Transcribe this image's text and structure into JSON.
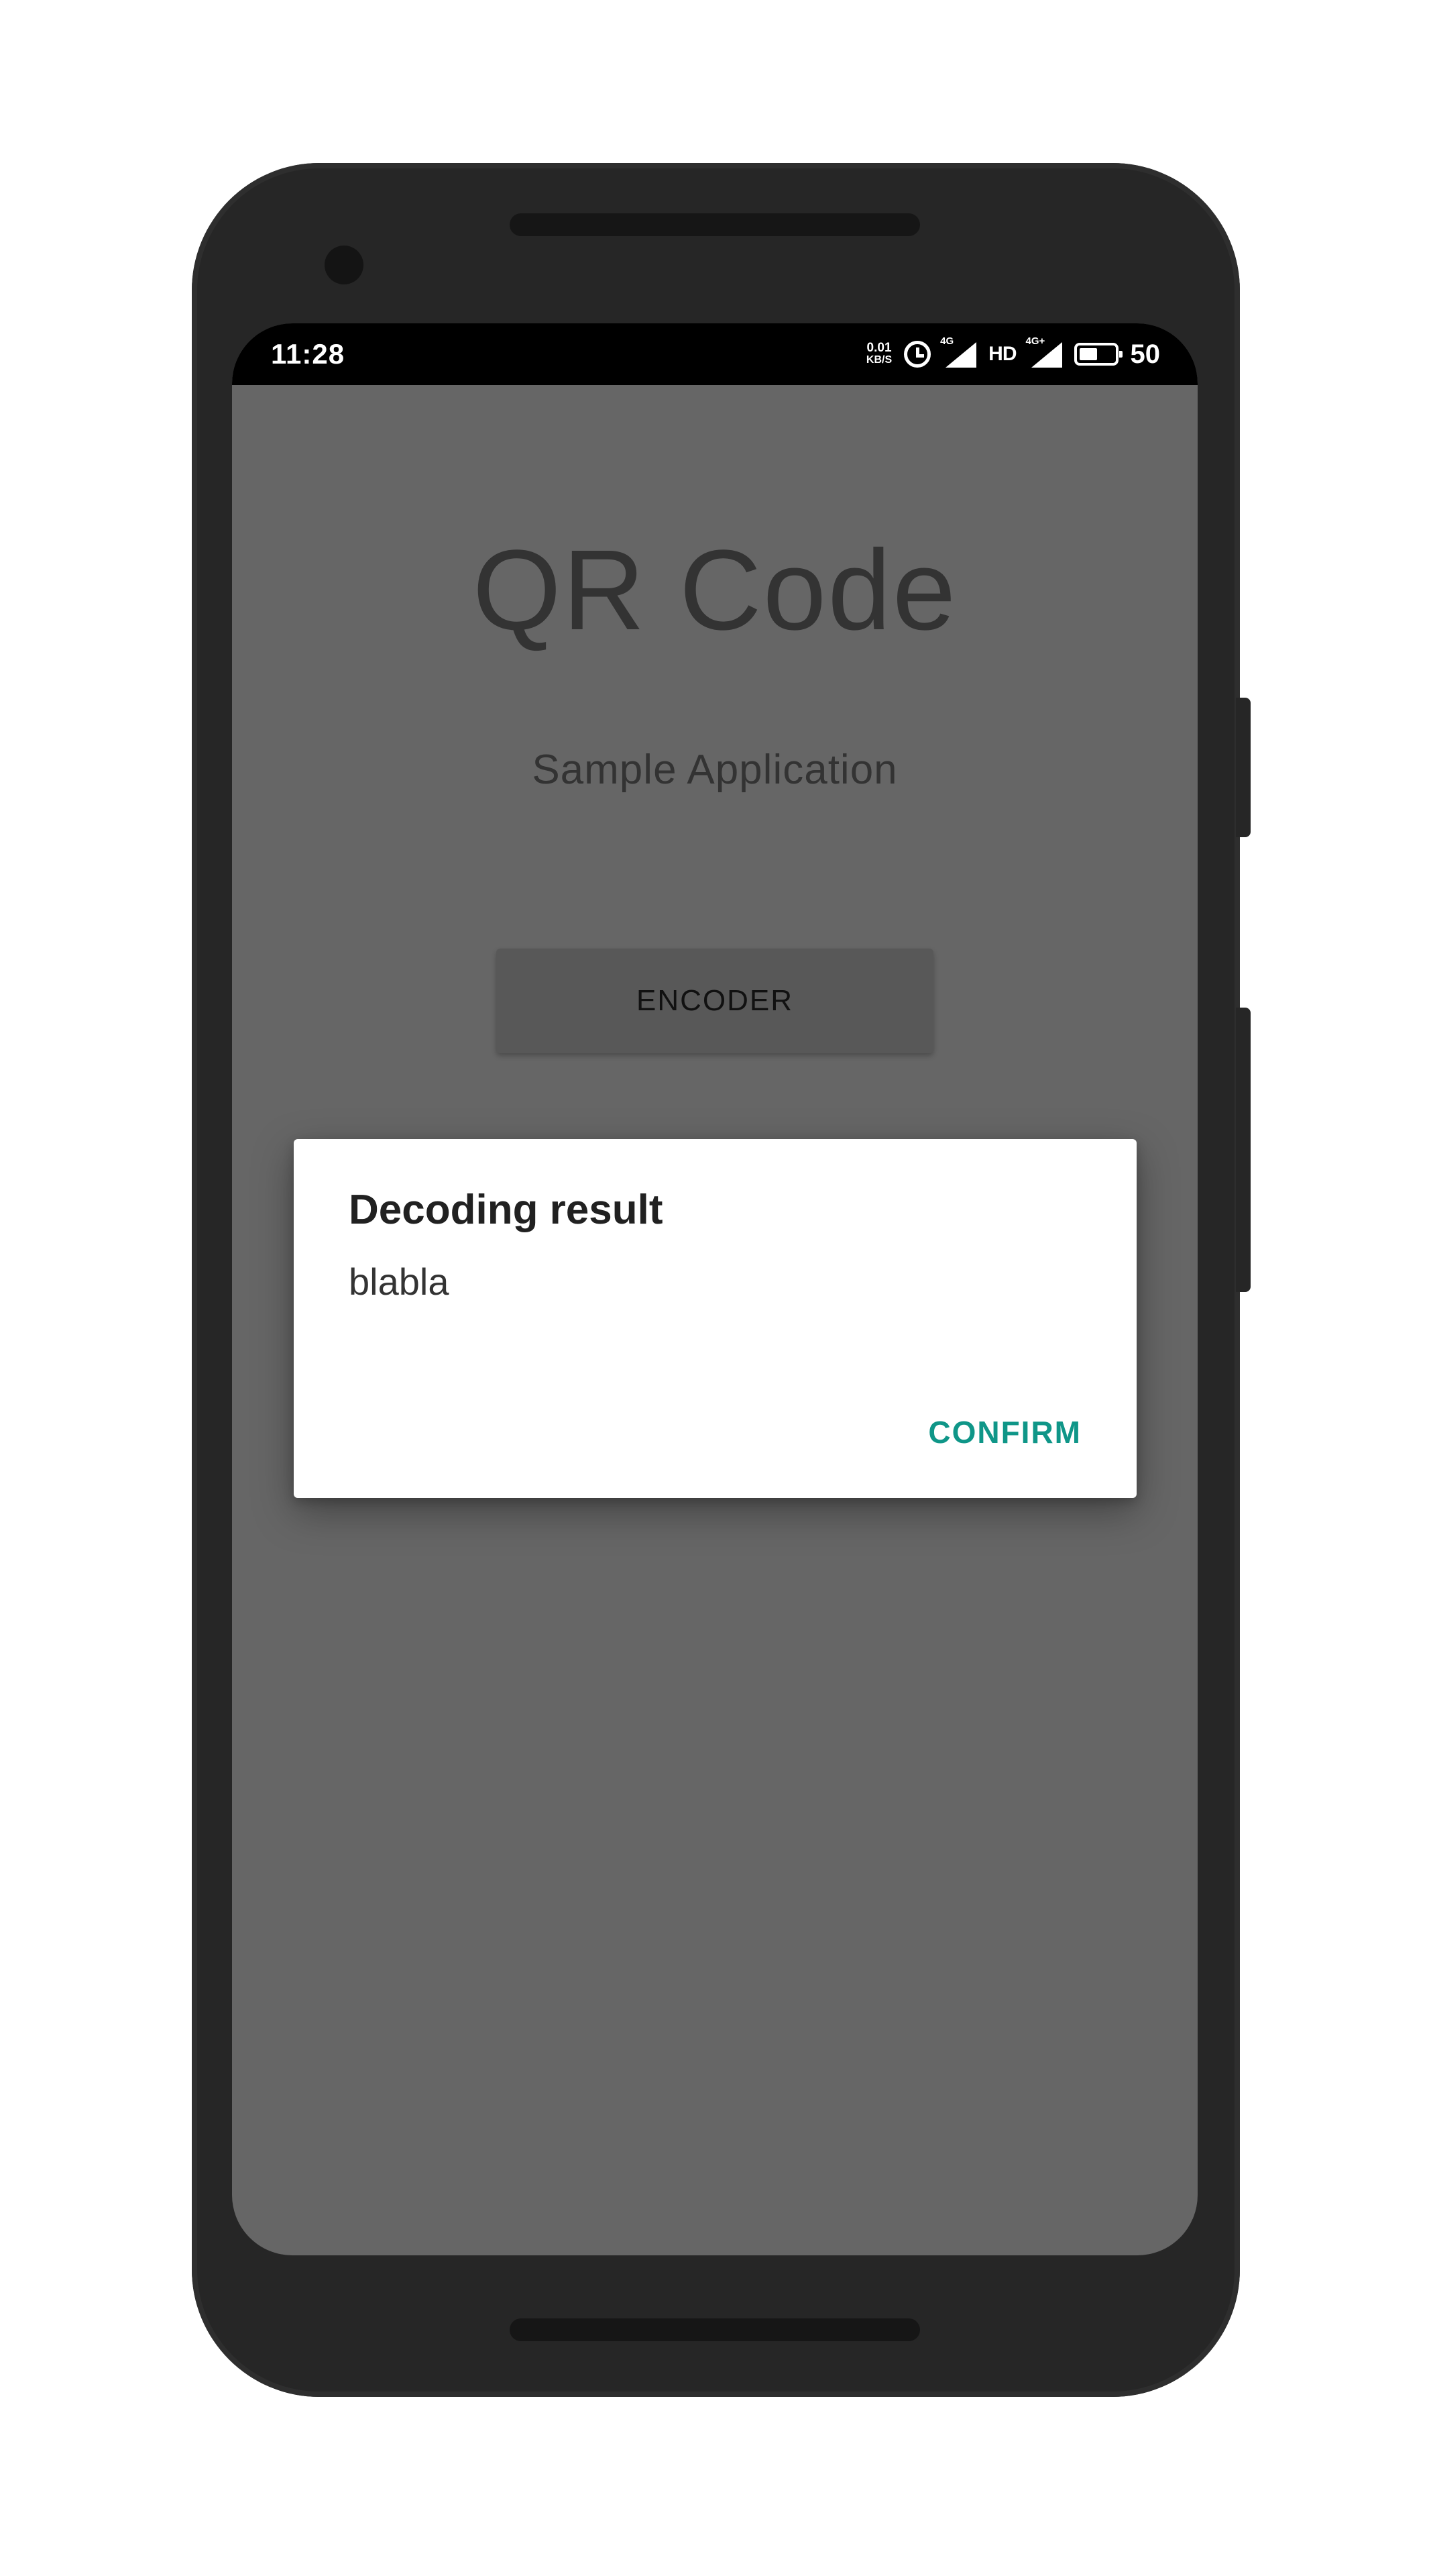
{
  "status_bar": {
    "time": "11:28",
    "net_speed_value": "0.01",
    "net_speed_unit": "KB/S",
    "signal1_tag": "4G",
    "hd_label": "HD",
    "signal2_tag": "4G+",
    "battery_level": "50"
  },
  "app": {
    "title": "QR Code",
    "subtitle": "Sample Application",
    "encoder_label": "ENCODER"
  },
  "dialog": {
    "title": "Decoding result",
    "message": "blabla",
    "confirm_label": "CONFIRM"
  },
  "colors": {
    "accent": "#0f9688",
    "scrim": "#666666",
    "phone_frame": "#262626"
  }
}
